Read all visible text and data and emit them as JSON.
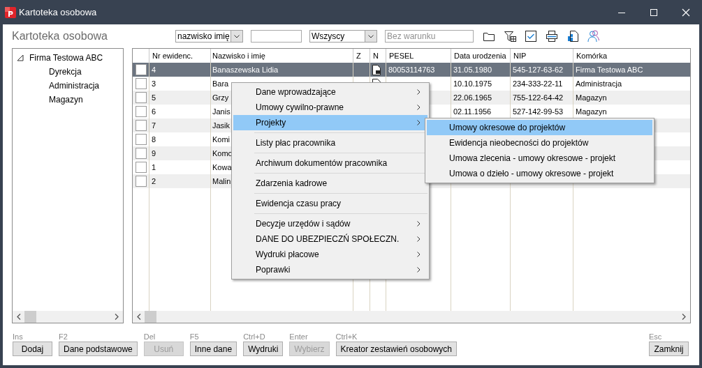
{
  "window": {
    "title": "Kartoteka osobowa"
  },
  "header": {
    "title": "Kartoteka osobowa",
    "sort_field": {
      "value": "nazwisko imię"
    },
    "group_filter": {
      "value": "Wszyscy"
    },
    "condition": {
      "placeholder": "Bez warunku"
    }
  },
  "tree": {
    "items": [
      {
        "label": "Firma Testowa ABC",
        "expanded": true,
        "children": [
          {
            "label": "Dyrekcja"
          },
          {
            "label": "Administracja"
          },
          {
            "label": "Magazyn"
          }
        ]
      }
    ]
  },
  "table": {
    "columns": [
      "Nr ewidenc.",
      "Nazwisko i imię",
      "Z",
      "N",
      "PESEL",
      "Data urodzenia",
      "NIP",
      "Komórka"
    ],
    "rows": [
      {
        "selected": true,
        "checked": false,
        "nr": "4",
        "name": "Banaszewska Lidia",
        "document": true,
        "pesel": "80053114763",
        "birth_date": "31.05.1980",
        "nip": "545-127-63-62",
        "unit": "Firma Testowa ABC"
      },
      {
        "selected": false,
        "checked": false,
        "nr": "3",
        "name": "Bara",
        "document": true,
        "birth_date": "10.10.1975",
        "nip": "234-333-22-11",
        "unit": "Administracja"
      },
      {
        "selected": false,
        "checked": false,
        "nr": "5",
        "name": "Grzy",
        "birth_date": "22.06.1965",
        "nip": "755-122-64-42",
        "unit": "Magazyn"
      },
      {
        "selected": false,
        "checked": false,
        "nr": "6",
        "name": "Janis",
        "birth_date": "02.11.1956",
        "nip": "527-142-99-53",
        "unit": "Magazyn"
      },
      {
        "selected": false,
        "checked": false,
        "nr": "7",
        "name": "Jasik"
      },
      {
        "selected": false,
        "checked": false,
        "nr": "8",
        "name": "Komi"
      },
      {
        "selected": false,
        "checked": false,
        "nr": "9",
        "name": "Komo"
      },
      {
        "selected": false,
        "checked": false,
        "nr": "1",
        "name": "Kowa"
      },
      {
        "selected": false,
        "checked": false,
        "nr": "2",
        "name": "Malin"
      }
    ]
  },
  "context_menu": {
    "items": [
      {
        "kind": "item",
        "label": "Dane wprowadzające",
        "submenu": true,
        "selected": false
      },
      {
        "kind": "item",
        "label": "Umowy cywilno-prawne",
        "submenu": true,
        "selected": false
      },
      {
        "kind": "item",
        "label": "Projekty",
        "submenu": true,
        "selected": true
      },
      {
        "kind": "separator"
      },
      {
        "kind": "item",
        "label": "Listy płac pracownika",
        "submenu": false,
        "selected": false
      },
      {
        "kind": "separator"
      },
      {
        "kind": "item",
        "label": "Archiwum dokumentów pracownika",
        "submenu": false,
        "selected": false
      },
      {
        "kind": "separator"
      },
      {
        "kind": "item",
        "label": "Zdarzenia kadrowe",
        "submenu": false,
        "selected": false
      },
      {
        "kind": "separator"
      },
      {
        "kind": "item",
        "label": "Ewidencja czasu pracy",
        "submenu": false,
        "selected": false
      },
      {
        "kind": "separator"
      },
      {
        "kind": "item",
        "label": "Decyzje urzędów i sądów",
        "submenu": true,
        "selected": false
      },
      {
        "kind": "item",
        "label": "DANE DO UBEZPIECZŃ SPOŁECZN.",
        "submenu": true,
        "selected": false
      },
      {
        "kind": "item",
        "label": "Wydruki płacowe",
        "submenu": true,
        "selected": false
      },
      {
        "kind": "item",
        "label": "Poprawki",
        "submenu": true,
        "selected": false
      }
    ]
  },
  "submenu": {
    "items": [
      {
        "label": "Umowy okresowe do projektów",
        "selected": true
      },
      {
        "label": "Ewidencja nieobecności do projektów",
        "selected": false
      },
      {
        "label": "Umowa zlecenia - umowy okresowe - projekt",
        "selected": false
      },
      {
        "label": "Umowa o dzieło - umowy okresowe - projekt",
        "selected": false
      }
    ]
  },
  "footer": {
    "buttons": [
      {
        "shortcut": "Ins",
        "label": "Dodaj",
        "disabled": false
      },
      {
        "shortcut": "F2",
        "label": "Dane podstawowe",
        "disabled": false
      },
      {
        "shortcut": "Del",
        "label": "Usuń",
        "disabled": true
      },
      {
        "shortcut": "F5",
        "label": "Inne dane",
        "disabled": false
      },
      {
        "shortcut": "Ctrl+D",
        "label": "Wydruki",
        "disabled": false
      },
      {
        "shortcut": "Enter",
        "label": "Wybierz",
        "disabled": true
      },
      {
        "shortcut": "Ctrl+K",
        "label": "Kreator zestawień osobowych",
        "disabled": false
      }
    ],
    "close": {
      "shortcut": "Esc",
      "label": "Zamknij",
      "disabled": false
    }
  }
}
